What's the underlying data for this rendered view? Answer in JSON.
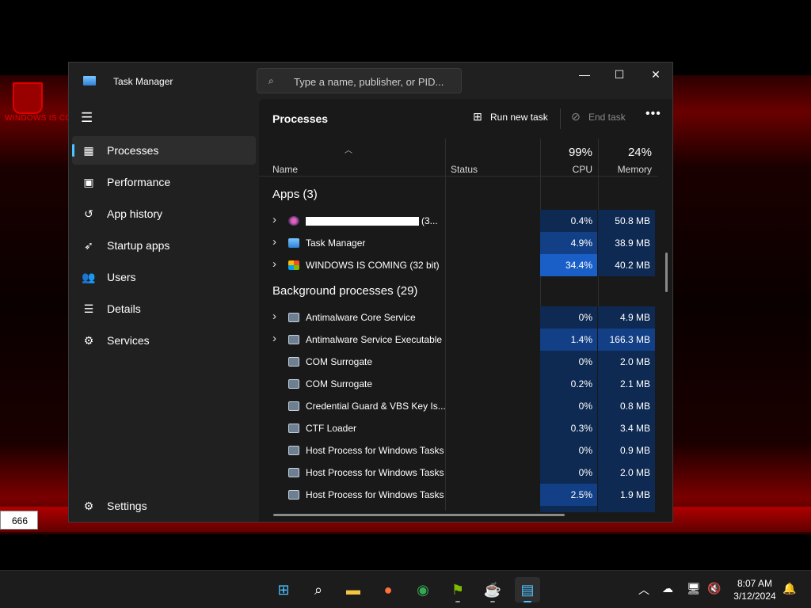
{
  "desktop": {
    "icon_caption": "WINDOWS IS CO",
    "counter_value": "666"
  },
  "window": {
    "title": "Task Manager",
    "search_placeholder": "Type a name, publisher, or PID...",
    "min_glyph": "—",
    "max_glyph": "☐",
    "close_glyph": "✕"
  },
  "sidebar": {
    "items": [
      {
        "label": "Processes",
        "icon": "processes-icon"
      },
      {
        "label": "Performance",
        "icon": "performance-icon"
      },
      {
        "label": "App history",
        "icon": "app-history-icon"
      },
      {
        "label": "Startup apps",
        "icon": "startup-apps-icon"
      },
      {
        "label": "Users",
        "icon": "users-icon"
      },
      {
        "label": "Details",
        "icon": "details-icon"
      },
      {
        "label": "Services",
        "icon": "services-icon"
      }
    ],
    "settings_label": "Settings"
  },
  "toolbar": {
    "page_title": "Processes",
    "run_new_task": "Run new task",
    "end_task": "End task",
    "more": "•••"
  },
  "columns": {
    "name": "Name",
    "status": "Status",
    "cpu_total": "99%",
    "cpu": "CPU",
    "memory_total": "24%",
    "memory": "Memory"
  },
  "groups": {
    "apps": "Apps (3)",
    "background": "Background processes (29)"
  },
  "apps": [
    {
      "name": "",
      "suffix": "(3...",
      "cpu": "0.4%",
      "memory": "50.8 MB",
      "expandable": true,
      "icon": "app",
      "redacted": true
    },
    {
      "name": "Task Manager",
      "cpu": "4.9%",
      "memory": "38.9 MB",
      "expandable": true,
      "icon": "tm"
    },
    {
      "name": "WINDOWS IS COMING (32 bit)",
      "cpu": "34.4%",
      "memory": "40.2 MB",
      "expandable": true,
      "icon": "win"
    }
  ],
  "background": [
    {
      "name": "Antimalware Core Service",
      "cpu": "0%",
      "memory": "4.9 MB",
      "expandable": true
    },
    {
      "name": "Antimalware Service Executable",
      "cpu": "1.4%",
      "memory": "166.3 MB",
      "expandable": true
    },
    {
      "name": "COM Surrogate",
      "cpu": "0%",
      "memory": "2.0 MB",
      "expandable": false
    },
    {
      "name": "COM Surrogate",
      "cpu": "0.2%",
      "memory": "2.1 MB",
      "expandable": false
    },
    {
      "name": "Credential Guard & VBS Key Is...",
      "cpu": "0%",
      "memory": "0.8 MB",
      "expandable": false
    },
    {
      "name": "CTF Loader",
      "cpu": "0.3%",
      "memory": "3.4 MB",
      "expandable": false
    },
    {
      "name": "Host Process for Windows Tasks",
      "cpu": "0%",
      "memory": "0.9 MB",
      "expandable": false
    },
    {
      "name": "Host Process for Windows Tasks",
      "cpu": "0%",
      "memory": "2.0 MB",
      "expandable": false
    },
    {
      "name": "Host Process for Windows Tasks",
      "cpu": "2.5%",
      "memory": "1.9 MB",
      "expandable": false
    }
  ],
  "taskbar": {
    "apps": [
      {
        "name": "start-icon",
        "glyph": "⊞",
        "color": "#4cc2ff",
        "running": false,
        "active": false
      },
      {
        "name": "search-icon",
        "glyph": "⌕",
        "color": "#ffffff",
        "running": false,
        "active": false
      },
      {
        "name": "file-explorer-icon",
        "glyph": "▬",
        "color": "#f5c542",
        "running": false,
        "active": false
      },
      {
        "name": "firefox-icon",
        "glyph": "●",
        "color": "#ff7139",
        "running": false,
        "active": false
      },
      {
        "name": "chrome-icon",
        "glyph": "◉",
        "color": "#34a853",
        "running": false,
        "active": false
      },
      {
        "name": "windows-is-coming-icon",
        "glyph": "⚑",
        "color": "#7fba00",
        "running": true,
        "active": false
      },
      {
        "name": "java-icon",
        "glyph": "☕",
        "color": "#e8e8e8",
        "running": true,
        "active": false
      },
      {
        "name": "task-manager-icon",
        "glyph": "▤",
        "color": "#4cc2ff",
        "running": true,
        "active": true
      }
    ],
    "tray": {
      "chevron": "︿",
      "cloud": "☁",
      "network": "🖥",
      "volume": "🔇",
      "bell": "🔔"
    },
    "time": "8:07 AM",
    "date": "3/12/2024"
  },
  "colors": {
    "accent": "#4cc2ff",
    "cpu_heat_low": "#0e2a52",
    "cpu_heat_mid": "#123f86",
    "cpu_heat_high": "#1a5fc7"
  }
}
